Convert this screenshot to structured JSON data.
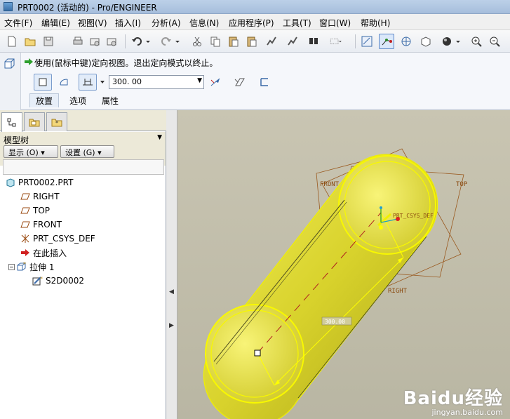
{
  "window": {
    "title": "PRT0002 (活动的) - Pro/ENGINEER"
  },
  "menubar": {
    "items": [
      "文件(F)",
      "编辑(E)",
      "视图(V)",
      "插入(I)",
      "分析(A)",
      "信息(N)",
      "应用程序(P)",
      "工具(T)",
      "窗口(W)",
      "帮助(H)"
    ]
  },
  "toolbar": {
    "icons": [
      "new-icon",
      "open-icon",
      "save-icon",
      "print-icon",
      "email-icon",
      "undo-icon",
      "redo-icon",
      "cut-icon",
      "copy-icon",
      "paste-icon",
      "paste-special-icon",
      "regenerate-icon",
      "find-icon",
      "select-box-icon",
      "datum-plane-display-icon",
      "datum-axis-display-icon",
      "datum-point-display-icon",
      "csys-display-icon",
      "shading-icon",
      "zoom-in-icon",
      "zoom-out-icon"
    ]
  },
  "dashboard": {
    "message": "使用(鼠标中键)定向视图。退出定向模式以终止。",
    "depth_value": "300. 00",
    "tabs": [
      "放置",
      "选项",
      "属性"
    ]
  },
  "model_tree": {
    "label": "模型树",
    "show_button": "显示 (O) ▾",
    "settings_button": "设置 (G) ▾",
    "items": [
      {
        "label": "PRT0002.PRT",
        "icon": "part-icon"
      },
      {
        "label": "RIGHT",
        "icon": "datum-plane-icon"
      },
      {
        "label": "TOP",
        "icon": "datum-plane-icon"
      },
      {
        "label": "FRONT",
        "icon": "datum-plane-icon"
      },
      {
        "label": "PRT_CSYS_DEF",
        "icon": "csys-icon"
      },
      {
        "label": "在此插入",
        "icon": "insert-arrow-icon"
      },
      {
        "label": "拉伸 1",
        "icon": "extrude-icon"
      },
      {
        "label": "S2D0002",
        "icon": "sketch-icon"
      }
    ]
  },
  "viewport": {
    "labels": {
      "front": "FRONT",
      "top": "TOP",
      "right": "RIGHT",
      "csys": "PRT_CSYS_DEF",
      "dimension": "300.00"
    }
  },
  "watermark": {
    "logo": "Baidu经验",
    "url": "jingyan.baidu.com"
  }
}
